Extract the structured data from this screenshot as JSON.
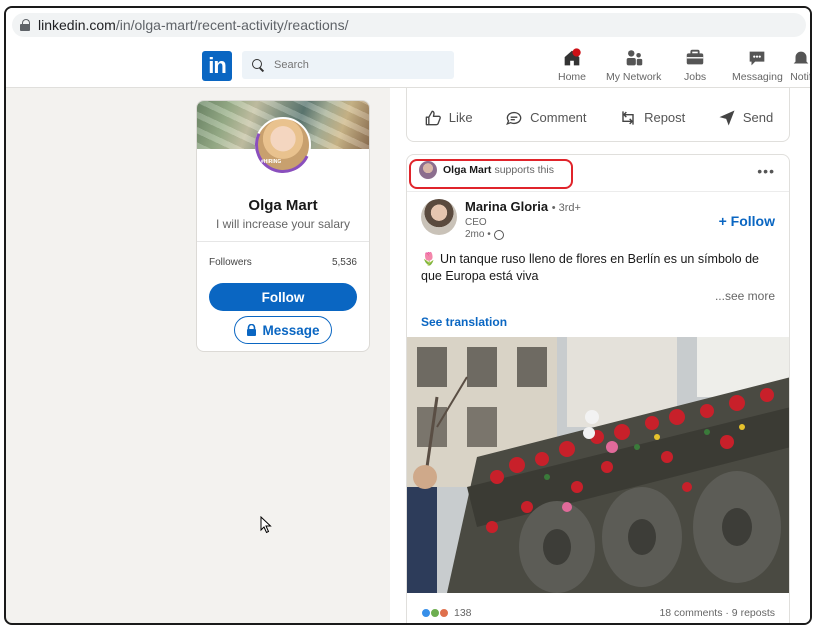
{
  "browser": {
    "url_host": "linkedin.com",
    "url_path": "/in/olga-mart/recent-activity/reactions/"
  },
  "nav": {
    "logo": "in",
    "search_placeholder": "Search",
    "items": [
      {
        "label": "Home"
      },
      {
        "label": "My Network"
      },
      {
        "label": "Jobs"
      },
      {
        "label": "Messaging"
      },
      {
        "label": "Notif"
      }
    ]
  },
  "profile": {
    "name": "Olga Mart",
    "headline": "I will increase your salary",
    "badge": "#HIRING",
    "followers_label": "Followers",
    "followers_count": "5,536",
    "follow_button": "Follow",
    "message_button": "Message"
  },
  "actions": {
    "like": "Like",
    "comment": "Comment",
    "repost": "Repost",
    "send": "Send"
  },
  "post": {
    "supporter": "Olga Mart",
    "supports_text": "supports this",
    "more": "•••",
    "author": "Marina Gloria",
    "degree": "• 3rd+",
    "role": "CEO",
    "time": "2mo •",
    "follow": "+ Follow",
    "text": "🌷 Un tanque ruso lleno de flores en Berlín es un símbolo de que Europa está viva",
    "see_more": "...see more",
    "see_translation": "See translation",
    "reactions_count": "138",
    "stats": "18 comments · 9 reposts"
  },
  "colors": {
    "brand": "#0a66c2",
    "highlight": "#e0242b",
    "notification": "#cc1016"
  }
}
